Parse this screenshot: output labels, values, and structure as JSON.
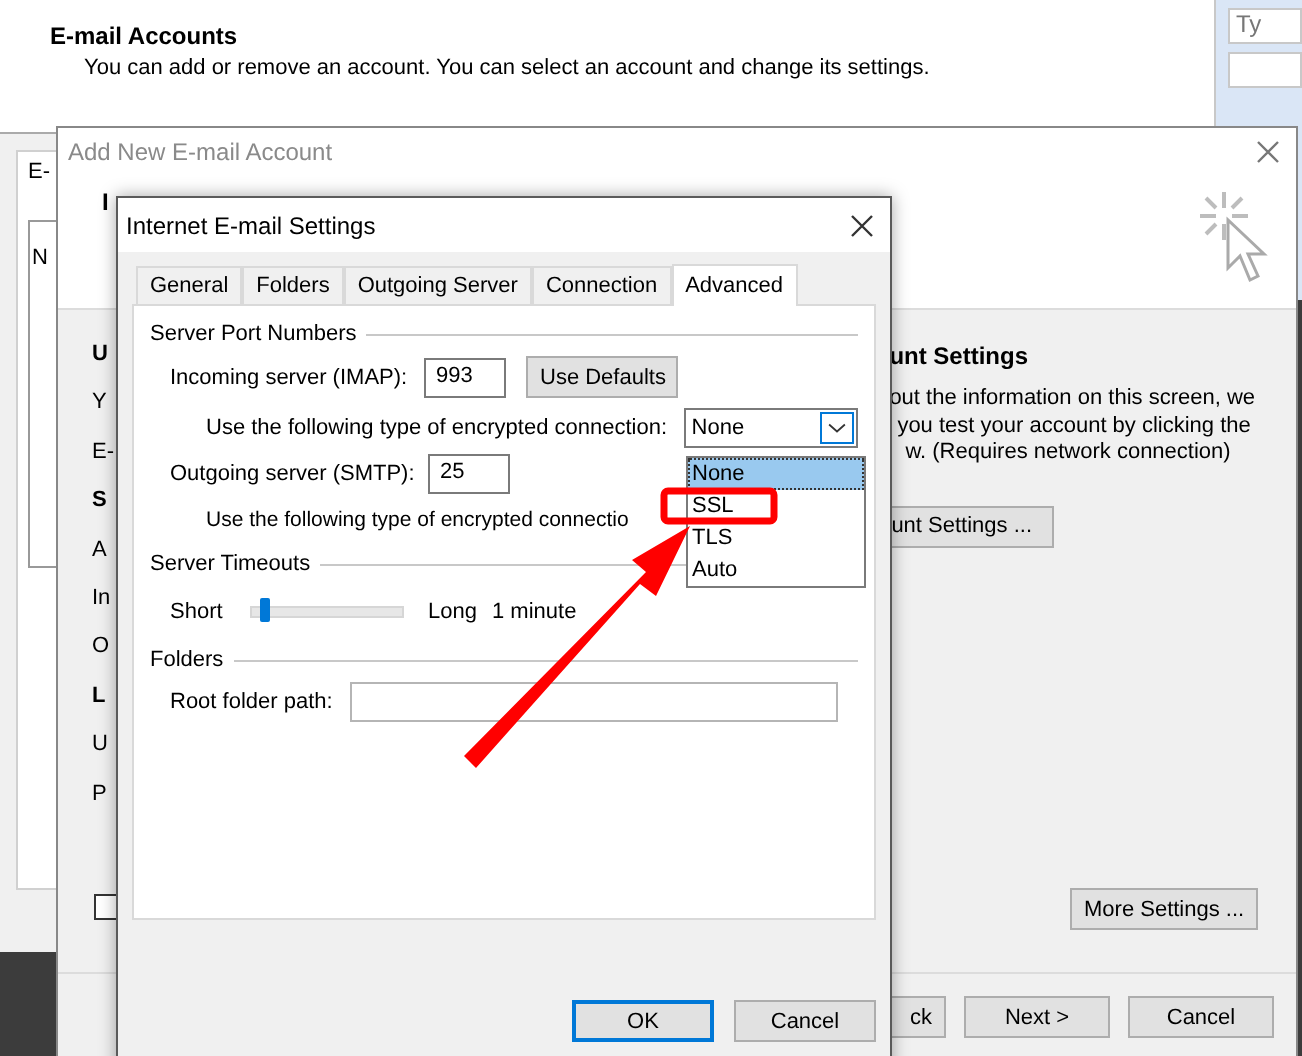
{
  "back_window": {
    "heading": "E-mail Accounts",
    "description": "You can add or remove an account. You can select an account and change its settings.",
    "tab_fragment": "E-",
    "list_fragment": "N",
    "search_fragment": "Ty"
  },
  "add_account_dialog": {
    "title": "Add New E-mail Account",
    "header_fragment": "I",
    "left_fragments": [
      {
        "text": "U",
        "kind": "heading"
      },
      {
        "text": "Y",
        "kind": "text"
      },
      {
        "text": "E-",
        "kind": "text"
      },
      {
        "text": "S",
        "kind": "heading"
      },
      {
        "text": "A",
        "kind": "text"
      },
      {
        "text": "In",
        "kind": "text"
      },
      {
        "text": "O",
        "kind": "text"
      },
      {
        "text": "L",
        "kind": "heading"
      },
      {
        "text": "U",
        "kind": "text"
      },
      {
        "text": "P",
        "kind": "text"
      }
    ],
    "section_heading": "unt Settings",
    "info_lines": [
      "out the information on this screen, we",
      "you test your account by clicking the",
      "w. (Requires network connection)"
    ],
    "test_button": "unt Settings ...",
    "remember_checked": false,
    "more_settings_button": "More Settings ...",
    "nav_buttons": [
      "ck",
      "Next >",
      "Cancel"
    ]
  },
  "settings_dialog": {
    "title": "Internet E-mail Settings",
    "tabs": [
      {
        "label": "General",
        "selected": false
      },
      {
        "label": "Folders",
        "selected": false
      },
      {
        "label": "Outgoing Server",
        "selected": false
      },
      {
        "label": "Connection",
        "selected": false
      },
      {
        "label": "Advanced",
        "selected": true
      }
    ],
    "port_group": "Server Port Numbers",
    "incoming_label": "Incoming server (IMAP):",
    "incoming_port": "993",
    "use_defaults_button": "Use Defaults",
    "encryption_label_1": "Use the following type of encrypted connection:",
    "encryption_value": "None",
    "outgoing_label": "Outgoing server (SMTP):",
    "outgoing_port": "25",
    "encryption_label_2": "Use the following type of encrypted connectio",
    "encryption_options": [
      {
        "label": "None",
        "selected": true
      },
      {
        "label": "SSL",
        "selected": false
      },
      {
        "label": "TLS",
        "selected": false
      },
      {
        "label": "Auto",
        "selected": false
      }
    ],
    "timeout_group": "Server Timeouts",
    "timeout_short": "Short",
    "timeout_long": "Long",
    "timeout": {
      "level": 0.08
    },
    "timeout_value": "1 minute",
    "folders_group": "Folders",
    "root_folder_label": "Root folder path:",
    "buttons": [
      "OK",
      "Cancel"
    ]
  }
}
